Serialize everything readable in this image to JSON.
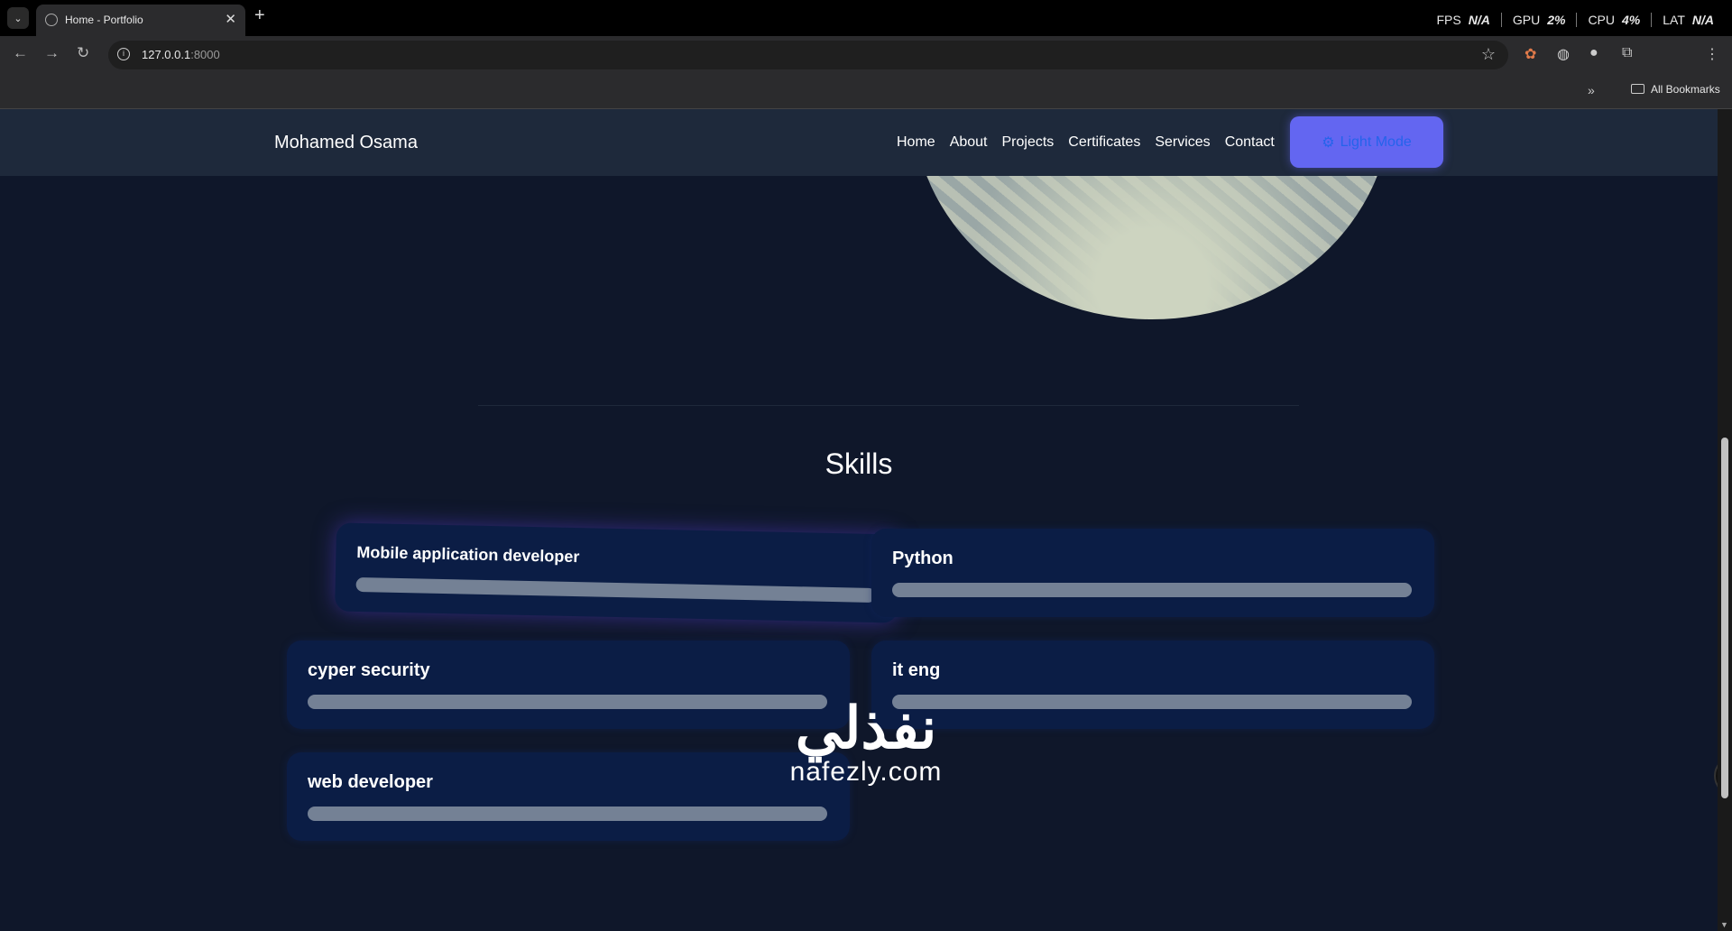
{
  "browser": {
    "tab_title": "Home - Portfolio",
    "url_host": "127.0.0.1",
    "url_port": ":8000",
    "bookmarks_label": "All Bookmarks",
    "perf": [
      {
        "label": "FPS",
        "value": "N/A"
      },
      {
        "label": "GPU",
        "value": "2%"
      },
      {
        "label": "CPU",
        "value": "4%"
      },
      {
        "label": "LAT",
        "value": "N/A"
      }
    ]
  },
  "navbar": {
    "brand": "Mohamed Osama",
    "links": [
      "Home",
      "About",
      "Projects",
      "Certificates",
      "Services",
      "Contact"
    ],
    "mode_button": "Light Mode"
  },
  "skills": {
    "title": "Skills",
    "items": [
      {
        "name": "Mobile application developer",
        "level": 1.0
      },
      {
        "name": "Python",
        "level": 1.0
      },
      {
        "name": "cyper security",
        "level": 1.0
      },
      {
        "name": "it eng",
        "level": 1.0
      },
      {
        "name": "web developer",
        "level": 1.0
      }
    ]
  },
  "watermark": {
    "arabic": "نفذلي",
    "latin": "nafezly.com"
  }
}
